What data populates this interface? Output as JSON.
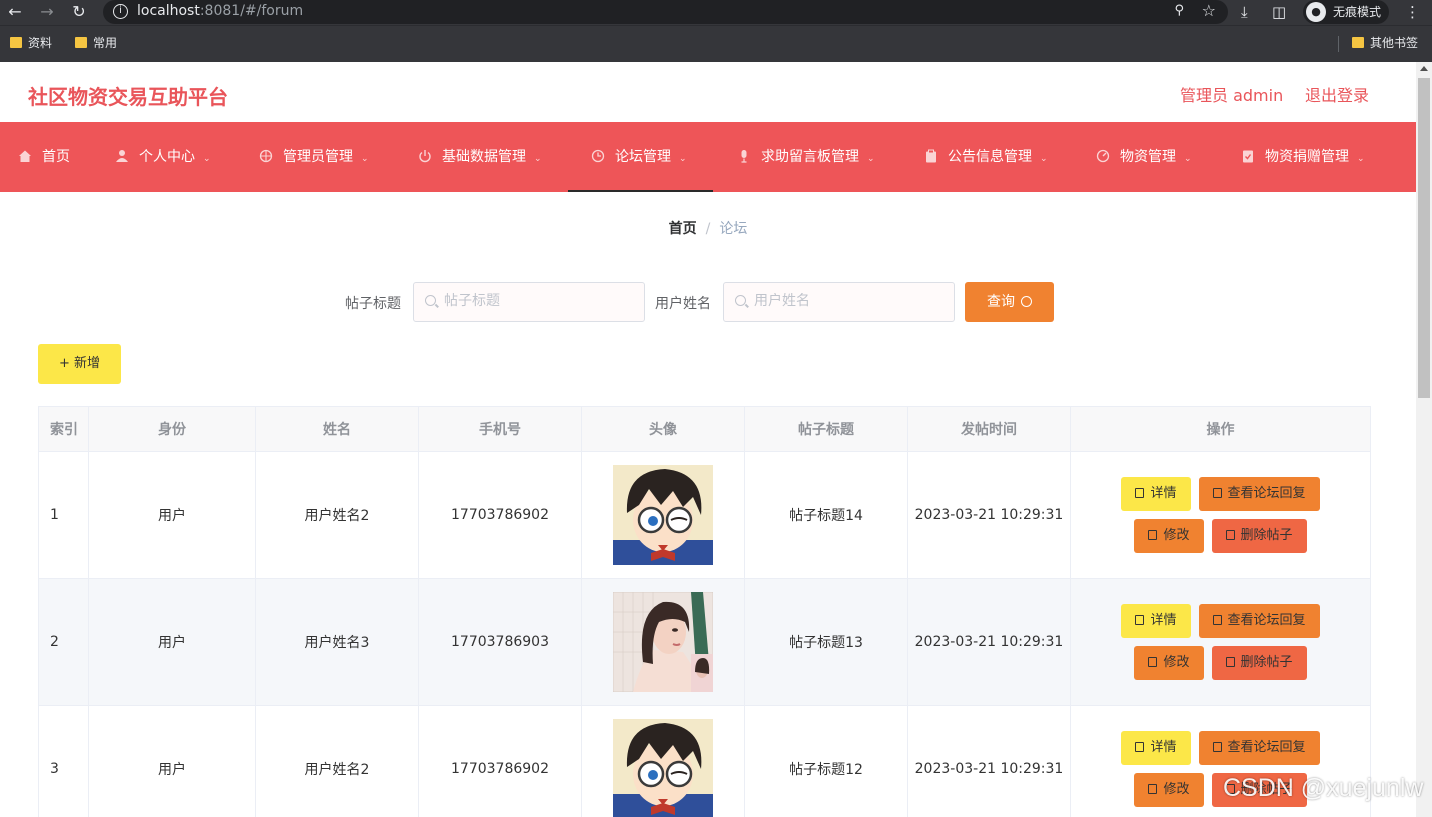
{
  "browser": {
    "url_host": "localhost",
    "url_rest": ":8081/#/forum",
    "incognito_label": "无痕模式",
    "bookmarks": [
      "资料",
      "常用"
    ],
    "other_bookmarks": "其他书签"
  },
  "header": {
    "title": "社区物资交易互助平台",
    "admin_label": "管理员 admin",
    "logout_label": "退出登录"
  },
  "menu": {
    "items": [
      {
        "label": "首页",
        "icon": "home-icon",
        "has_dropdown": false
      },
      {
        "label": "个人中心",
        "icon": "user-icon",
        "has_dropdown": true
      },
      {
        "label": "管理员管理",
        "icon": "crosshair-icon",
        "has_dropdown": true
      },
      {
        "label": "基础数据管理",
        "icon": "power-icon",
        "has_dropdown": true
      },
      {
        "label": "论坛管理",
        "icon": "clock-icon",
        "has_dropdown": true,
        "active": true
      },
      {
        "label": "求助留言板管理",
        "icon": "microphone-icon",
        "has_dropdown": true
      },
      {
        "label": "公告信息管理",
        "icon": "clipboard-icon",
        "has_dropdown": true
      },
      {
        "label": "物资管理",
        "icon": "gauge-icon",
        "has_dropdown": true
      },
      {
        "label": "物资捐赠管理",
        "icon": "checklist-icon",
        "has_dropdown": true
      }
    ]
  },
  "breadcrumb": {
    "home": "首页",
    "separator": "/",
    "current": "论坛"
  },
  "search": {
    "title_label": "帖子标题",
    "title_placeholder": "帖子标题",
    "title_value": "",
    "name_label": "用户姓名",
    "name_placeholder": "用户姓名",
    "name_value": "",
    "query_label": "查询"
  },
  "add_label": "+ 新增",
  "table": {
    "columns": [
      "索引",
      "身份",
      "姓名",
      "手机号",
      "头像",
      "帖子标题",
      "发帖时间",
      "操作"
    ],
    "rows": [
      {
        "index": "1",
        "role": "用户",
        "name": "用户姓名2",
        "phone": "17703786902",
        "avatar": "cartoon-boy-glasses",
        "title": "帖子标题14",
        "time": "2023-03-21 10:29:31"
      },
      {
        "index": "2",
        "role": "用户",
        "name": "用户姓名3",
        "phone": "17703786903",
        "avatar": "illustrated-woman",
        "title": "帖子标题13",
        "time": "2023-03-21 10:29:31"
      },
      {
        "index": "3",
        "role": "用户",
        "name": "用户姓名2",
        "phone": "17703786902",
        "avatar": "cartoon-boy-glasses",
        "title": "帖子标题12",
        "time": "2023-03-21 10:29:31"
      }
    ],
    "actions": {
      "detail": "详情",
      "view_replies": "查看论坛回复",
      "edit": "修改",
      "delete": "删除帖子"
    }
  },
  "watermark": "CSDN @xuejunlw",
  "colors": {
    "brand": "#ee5558",
    "title_red": "#e9555a",
    "orange": "#f08230",
    "yellow": "#fce748",
    "red_btn": "#ef6744"
  }
}
